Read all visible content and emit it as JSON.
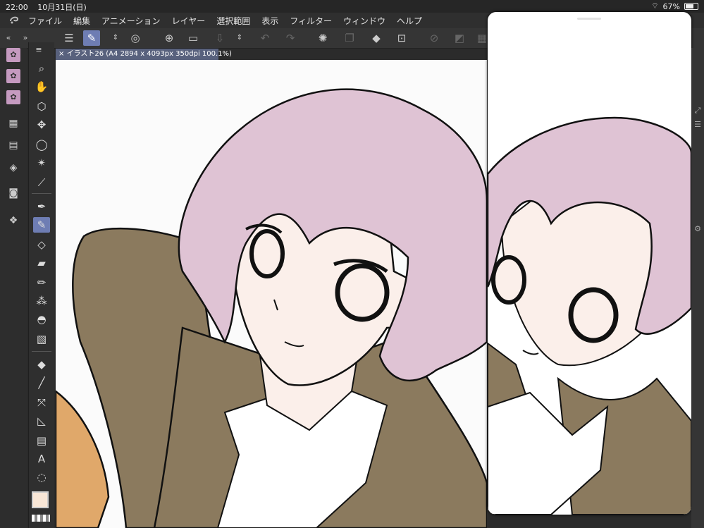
{
  "status": {
    "time": "22:00",
    "date": "10月31日(日)",
    "battery": "67%"
  },
  "menu": [
    "ファイル",
    "編集",
    "アニメーション",
    "レイヤー",
    "選択範囲",
    "表示",
    "フィルター",
    "ウィンドウ",
    "ヘルプ"
  ],
  "tab": {
    "close": "×",
    "title": "イラスト26 (A4 2894 x 4093px 350dpi 100.1%)"
  },
  "colors": {
    "hair": "#dfc3d4",
    "skin": "#fbefea",
    "sweater": "#8b7a5e",
    "orange": "#e0a86a",
    "accent": "#6e7db3",
    "main_color": "#f8e6d6"
  },
  "left_collapse": "«",
  "left_expand": "»",
  "tool_menu": "≡"
}
